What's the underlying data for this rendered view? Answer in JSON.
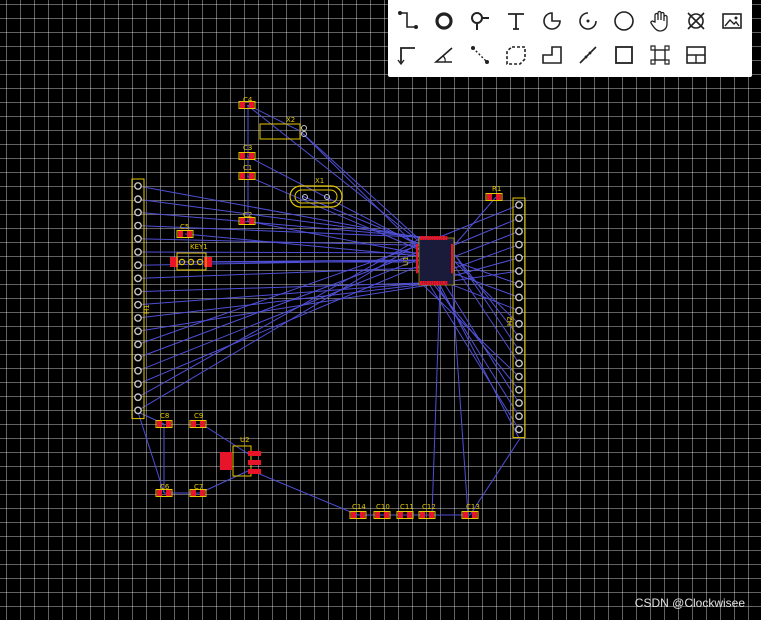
{
  "toolbar": {
    "tools": [
      "wire-tool-icon",
      "via-tool-icon",
      "probe-tool-icon",
      "text-tool-icon",
      "arc-center-icon",
      "arc-three-point-icon",
      "circle-tool-icon",
      "pan-hand-icon",
      "x-circle-icon",
      "image-icon",
      "dimension-tool-icon",
      "angle-tool-icon",
      "measure-tool-icon",
      "dashed-rect-icon",
      "polyline-tool-icon",
      "diagonal-dimension-icon",
      "rectangle-tool-icon",
      "component-frame-icon",
      "layout-panel-icon"
    ]
  },
  "components": {
    "C4": "C4",
    "X2": "X2",
    "C3": "C3",
    "C1": "C1",
    "X1": "X1",
    "C2": "C2",
    "C5": "C5",
    "KEY1": "KEY1",
    "R1": "R1",
    "U1": "U1",
    "H1": "H1",
    "H2": "H2",
    "C8": "C8",
    "C9": "C9",
    "U2": "U2",
    "C6": "C6",
    "C7": "C7",
    "C14": "C14",
    "C10": "C10",
    "C11": "C11",
    "C12": "C12",
    "C13": "C13"
  },
  "colors": {
    "ratsnest": "#4f4fd6",
    "silkscreen": "#e6c800",
    "pad": "#e8152a",
    "background": "#000000"
  },
  "watermark": "CSDN @Clockwisee"
}
